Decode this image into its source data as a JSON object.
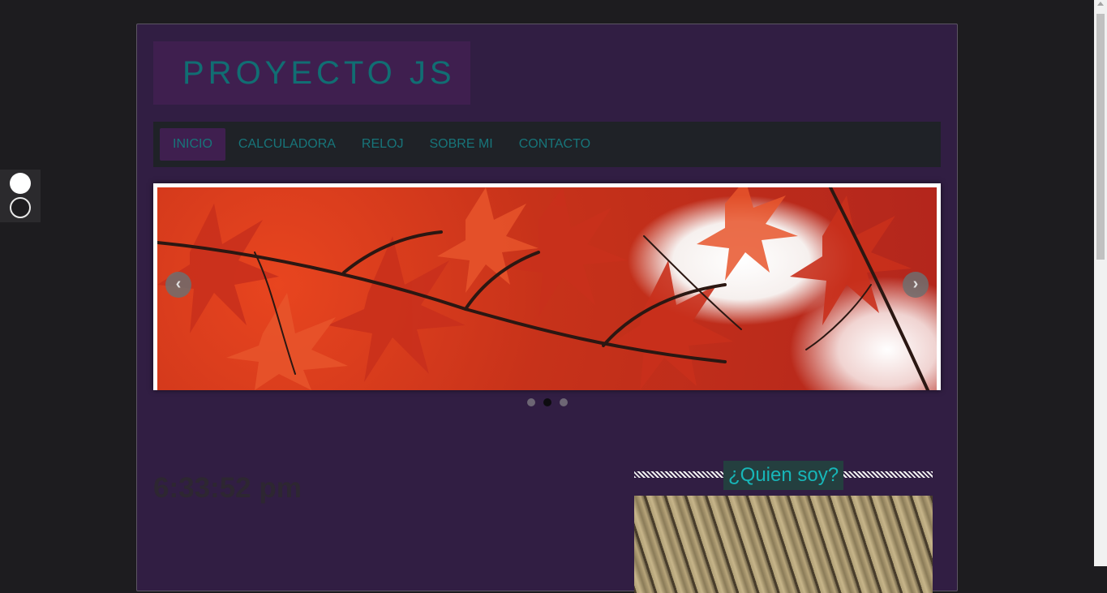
{
  "theme_switcher": {
    "options": [
      "light",
      "dark"
    ]
  },
  "header": {
    "logo_text": "PROYECTO JS"
  },
  "nav": {
    "items": [
      {
        "label": "INICIO",
        "active": true
      },
      {
        "label": "CALCULADORA",
        "active": false
      },
      {
        "label": "RELOJ",
        "active": false
      },
      {
        "label": "SOBRE MI",
        "active": false
      },
      {
        "label": "CONTACTO",
        "active": false
      }
    ]
  },
  "slider": {
    "image": "red autumn maple leaves",
    "prev_icon": "chevron-left-icon",
    "next_icon": "chevron-right-icon",
    "prev_symbol": "‹",
    "next_symbol": "›",
    "slide_count": 3,
    "active_slide": 2
  },
  "clock": {
    "time": "6:33:52 pm"
  },
  "sidebar": {
    "title": "¿Quien soy?",
    "image": "bamboo sticks"
  },
  "colors": {
    "page_background": "#1d1c1f",
    "container_background": "#311e43",
    "accent_text": "#17757a",
    "logo_background": "#3f1f4f",
    "nav_background": "#1f2227"
  }
}
